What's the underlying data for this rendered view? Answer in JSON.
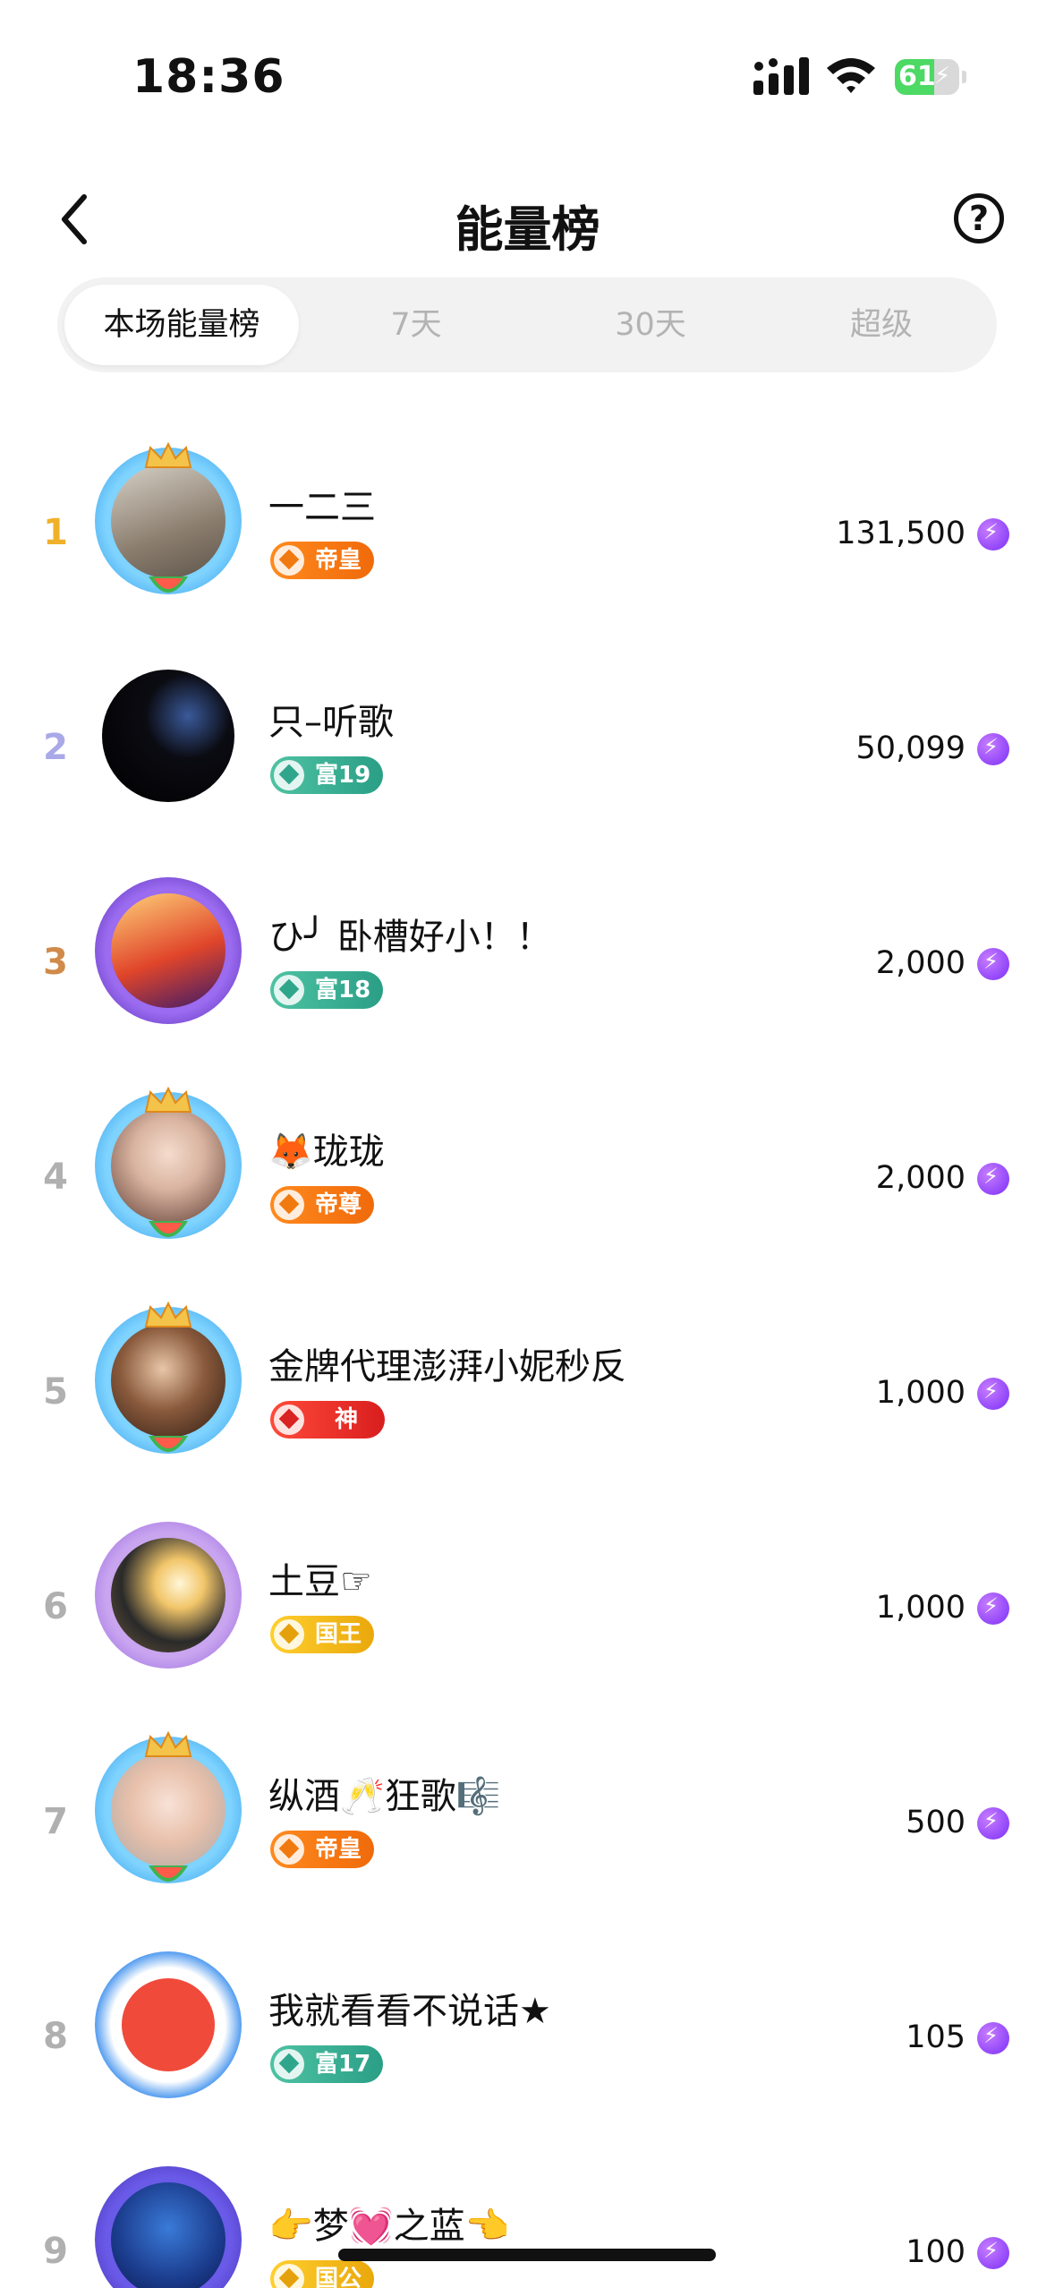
{
  "status_bar": {
    "time": "18:36",
    "battery": "61",
    "battery_level": 0.61
  },
  "header": {
    "title": "能量榜"
  },
  "tabs": [
    {
      "label": "本场能量榜",
      "active": true
    },
    {
      "label": "7天",
      "active": false
    },
    {
      "label": "30天",
      "active": false
    },
    {
      "label": "超级",
      "active": false
    }
  ],
  "ranking": [
    {
      "rank": "1",
      "name": "一二三",
      "badge": "帝皇",
      "badge_style": "orange",
      "score": "131,500"
    },
    {
      "rank": "2",
      "name": "只–听歌",
      "badge": "富19",
      "badge_style": "teal",
      "score": "50,099"
    },
    {
      "rank": "3",
      "name": "ひ╯ 卧槽好小！！",
      "badge": "富18",
      "badge_style": "teal",
      "score": "2,000"
    },
    {
      "rank": "4",
      "name": "🦊珑珑",
      "badge": "帝尊",
      "badge_style": "orange",
      "score": "2,000"
    },
    {
      "rank": "5",
      "name": "金牌代理澎湃小妮秒反",
      "badge": "神",
      "badge_style": "red",
      "score": "1,000"
    },
    {
      "rank": "6",
      "name": "土豆☞",
      "badge": "国王",
      "badge_style": "gold",
      "score": "1,000"
    },
    {
      "rank": "7",
      "name": "纵酒🥂狂歌🎼",
      "badge": "帝皇",
      "badge_style": "orange",
      "score": "500"
    },
    {
      "rank": "8",
      "name": "我就看看不说话★",
      "badge": "富17",
      "badge_style": "teal",
      "score": "105"
    },
    {
      "rank": "9",
      "name": "👉梦💓之蓝👈",
      "badge": "国公",
      "badge_style": "gold",
      "score": "100"
    }
  ],
  "colors": {
    "accent_energy": "#7b2ff7",
    "rank_gold": "#f0b12a",
    "rank_silver": "#a9a9e8",
    "rank_bronze": "#d08a4a"
  }
}
